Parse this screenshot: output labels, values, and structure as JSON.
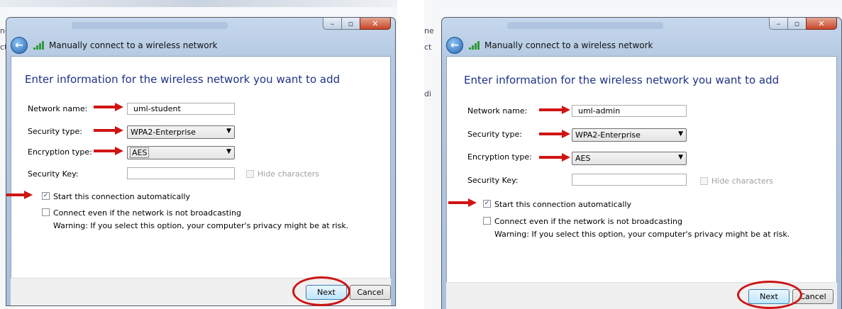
{
  "title": "Manually connect to a wireless network",
  "heading": "Enter information for the wireless network you want to add",
  "labels": {
    "network_name": "Network name:",
    "security_type": "Security type:",
    "encryption_type": "Encryption type:",
    "security_key": "Security Key:",
    "hide_characters": "Hide characters",
    "start_auto": "Start this connection automatically",
    "connect_even": "Connect even if the network is not broadcasting",
    "warning": "Warning: If you select this option, your computer's privacy might be at risk."
  },
  "buttons": {
    "next": "Next",
    "cancel": "Cancel"
  },
  "panels": [
    {
      "network_name": "uml-student",
      "security_type": "WPA2-Enterprise",
      "encryption_type": "AES",
      "security_key": "",
      "start_auto_checked": true,
      "connect_even_checked": false
    },
    {
      "network_name": "uml-admin",
      "security_type": "WPA2-Enterprise",
      "encryption_type": "AES",
      "security_key": "",
      "start_auto_checked": true,
      "connect_even_checked": false
    }
  ],
  "background_fragments": {
    "left": [
      "ne",
      "ct"
    ],
    "right": [
      "ne",
      "ct",
      "di"
    ]
  },
  "colors": {
    "annotation": "#d01414",
    "heading": "#1e3287"
  }
}
